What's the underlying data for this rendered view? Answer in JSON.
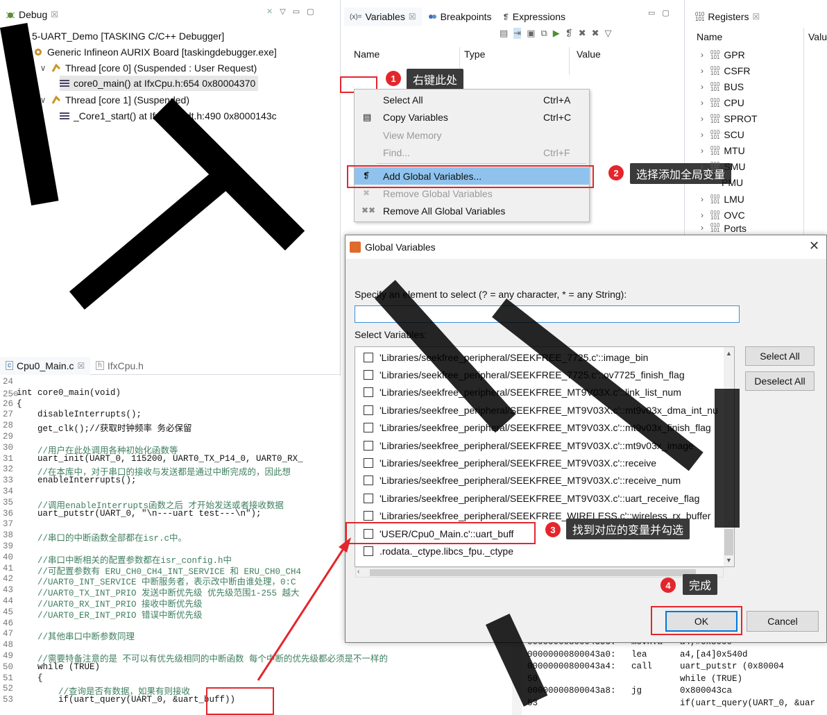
{
  "debug_view": {
    "tab": "Debug",
    "tree": [
      {
        "label": "5-UART_Demo [TASKING C/C++ Debugger]"
      },
      {
        "label": "Generic Infineon AURIX Board [taskingdebugger.exe]"
      },
      {
        "label": "Thread [core 0] (Suspended : User Request)"
      },
      {
        "label": "core0_main() at IfxCpu.h:654 0x80004370"
      },
      {
        "label": "Thread [core 1] (Suspended)"
      },
      {
        "label": "_Core1_start() at IfxScuWdt.h:490 0x8000143c"
      }
    ]
  },
  "variables_view": {
    "tabs": [
      "Variables",
      "Breakpoints",
      "Expressions"
    ],
    "columns": [
      "Name",
      "Type",
      "Value"
    ]
  },
  "context_menu": {
    "items": [
      {
        "label": "Select All",
        "shortcut": "Ctrl+A"
      },
      {
        "label": "Copy Variables",
        "shortcut": "Ctrl+C"
      },
      {
        "label": "View Memory",
        "shortcut": ""
      },
      {
        "label": "Find...",
        "shortcut": "Ctrl+F"
      },
      {
        "label": "Add Global Variables...",
        "shortcut": ""
      },
      {
        "label": "Remove Global Variables",
        "shortcut": ""
      },
      {
        "label": "Remove All Global Variables",
        "shortcut": ""
      }
    ]
  },
  "registers_view": {
    "tab": "Registers",
    "columns": [
      "Name",
      "Valu"
    ],
    "items": [
      "GPR",
      "CSFR",
      "BUS",
      "CPU",
      "SPROT",
      "SCU",
      "MTU",
      "SMU",
      "PMU",
      "LMU",
      "OVC",
      "Ports"
    ]
  },
  "annotations": {
    "step1": "右键此处",
    "step2": "选择添加全局变量",
    "step3": "找到对应的变量并勾选",
    "step4": "完成",
    "n1": "1",
    "n2": "2",
    "n3": "3",
    "n4": "4"
  },
  "dialog": {
    "title": "Global Variables",
    "prompt": "Specify an element to select (? = any character, * = any String):",
    "filter_value": "",
    "list_label": "Select Variables:",
    "items": [
      "'Libraries/seekfree_peripheral/SEEKFREE_7725.c'::image_bin",
      "'Libraries/seekfree_peripheral/SEEKFREE_7725.c'::ov7725_finish_flag",
      "'Libraries/seekfree_peripheral/SEEKFREE_MT9V03X.c'::link_list_num",
      "'Libraries/seekfree_peripheral/SEEKFREE_MT9V03X.c'::mt9v03x_dma_int_nu",
      "'Libraries/seekfree_peripheral/SEEKFREE_MT9V03X.c'::mt9v03x_finish_flag",
      "'Libraries/seekfree_peripheral/SEEKFREE_MT9V03X.c'::mt9v03x_image",
      "'Libraries/seekfree_peripheral/SEEKFREE_MT9V03X.c'::receive",
      "'Libraries/seekfree_peripheral/SEEKFREE_MT9V03X.c'::receive_num",
      "'Libraries/seekfree_peripheral/SEEKFREE_MT9V03X.c'::uart_receive_flag",
      "'Libraries/seekfree_peripheral/SEEKFREE_WIRELESS.c'::wireless_rx_buffer",
      "'USER/Cpu0_Main.c'::uart_buff",
      ".rodata._ctype.libcs_fpu._ctype"
    ],
    "select_all": "Select All",
    "deselect_all": "Deselect All",
    "ok": "OK",
    "cancel": "Cancel"
  },
  "editor": {
    "tabs": [
      "Cpu0_Main.c",
      "IfxCpu.h"
    ]
  },
  "code_lines": [
    {
      "n": "24",
      "t": ""
    },
    {
      "n": "25⊖",
      "t": "int core0_main(void)"
    },
    {
      "n": "26",
      "t": "{"
    },
    {
      "n": "27",
      "t": "    disableInterrupts();"
    },
    {
      "n": "28",
      "t": "    get_clk();//获取时钟频率 务必保留"
    },
    {
      "n": "29",
      "t": ""
    },
    {
      "n": "30",
      "t": "    //用户在此处调用各种初始化函数等"
    },
    {
      "n": "31",
      "t": "    uart_init(UART_0, 115200, UART0_TX_P14_0, UART0_RX_"
    },
    {
      "n": "32",
      "t": "    //在本库中，对于串口的接收与发送都是通过中断完成的，因此想"
    },
    {
      "n": "33",
      "t": "    enableInterrupts();"
    },
    {
      "n": "34",
      "t": ""
    },
    {
      "n": "35",
      "t": "    //调用enableInterrupts函数之后 才开始发送或者接收数据"
    },
    {
      "n": "36",
      "t": "    uart_putstr(UART_0, \"\\n---uart test---\\n\");"
    },
    {
      "n": "37",
      "t": ""
    },
    {
      "n": "38",
      "t": "    //串口的中断函数全部都在isr.c中。"
    },
    {
      "n": "39",
      "t": ""
    },
    {
      "n": "40",
      "t": "    //串口中断相关的配置参数都在isr_config.h中"
    },
    {
      "n": "41",
      "t": "    //可配置参数有 ERU_CH0_CH4_INT_SERVICE 和 ERU_CH0_CH4"
    },
    {
      "n": "42",
      "t": "    //UART0_INT_SERVICE 中断服务者，表示改中断由谁处理，0:C"
    },
    {
      "n": "43",
      "t": "    //UART0_TX_INT_PRIO 发送中断优先级 优先级范围1-255 越大"
    },
    {
      "n": "44",
      "t": "    //UART0_RX_INT_PRIO 接收中断优先级"
    },
    {
      "n": "45",
      "t": "    //UART0_ER_INT_PRIO 错误中断优先级"
    },
    {
      "n": "46",
      "t": ""
    },
    {
      "n": "47",
      "t": "    //其他串口中断参数同理"
    },
    {
      "n": "48",
      "t": ""
    },
    {
      "n": "49",
      "t": "    //需要特备注意的是 不可以有优先级相同的中断函数 每个中断的优先级都必须是不一样的"
    },
    {
      "n": "50",
      "t": "    while (TRUE)"
    },
    {
      "n": "51",
      "t": "    {"
    },
    {
      "n": "52",
      "t": "        //查询是否有数据，如果有则接收"
    },
    {
      "n": "53",
      "t": "        if(uart_query(UART_0, &uart_buff))"
    }
  ],
  "disassembly": [
    {
      "a": "000000008000439c:",
      "i": "movh.a",
      "o": "a4,#0x8000"
    },
    {
      "a": "00000000800043a0:",
      "i": "lea",
      "o": "a4,[a4]0x540d"
    },
    {
      "a": "00000000800043a4:",
      "i": "call",
      "o": "uart_putstr (0x80004"
    },
    {
      "a": "50",
      "i": "",
      "o": "while (TRUE)"
    },
    {
      "a": "00000000800043a8:",
      "i": "jg",
      "o": "0x800043ca"
    },
    {
      "a": "53",
      "i": "",
      "o": "if(uart_query(UART_0, &uar"
    }
  ]
}
